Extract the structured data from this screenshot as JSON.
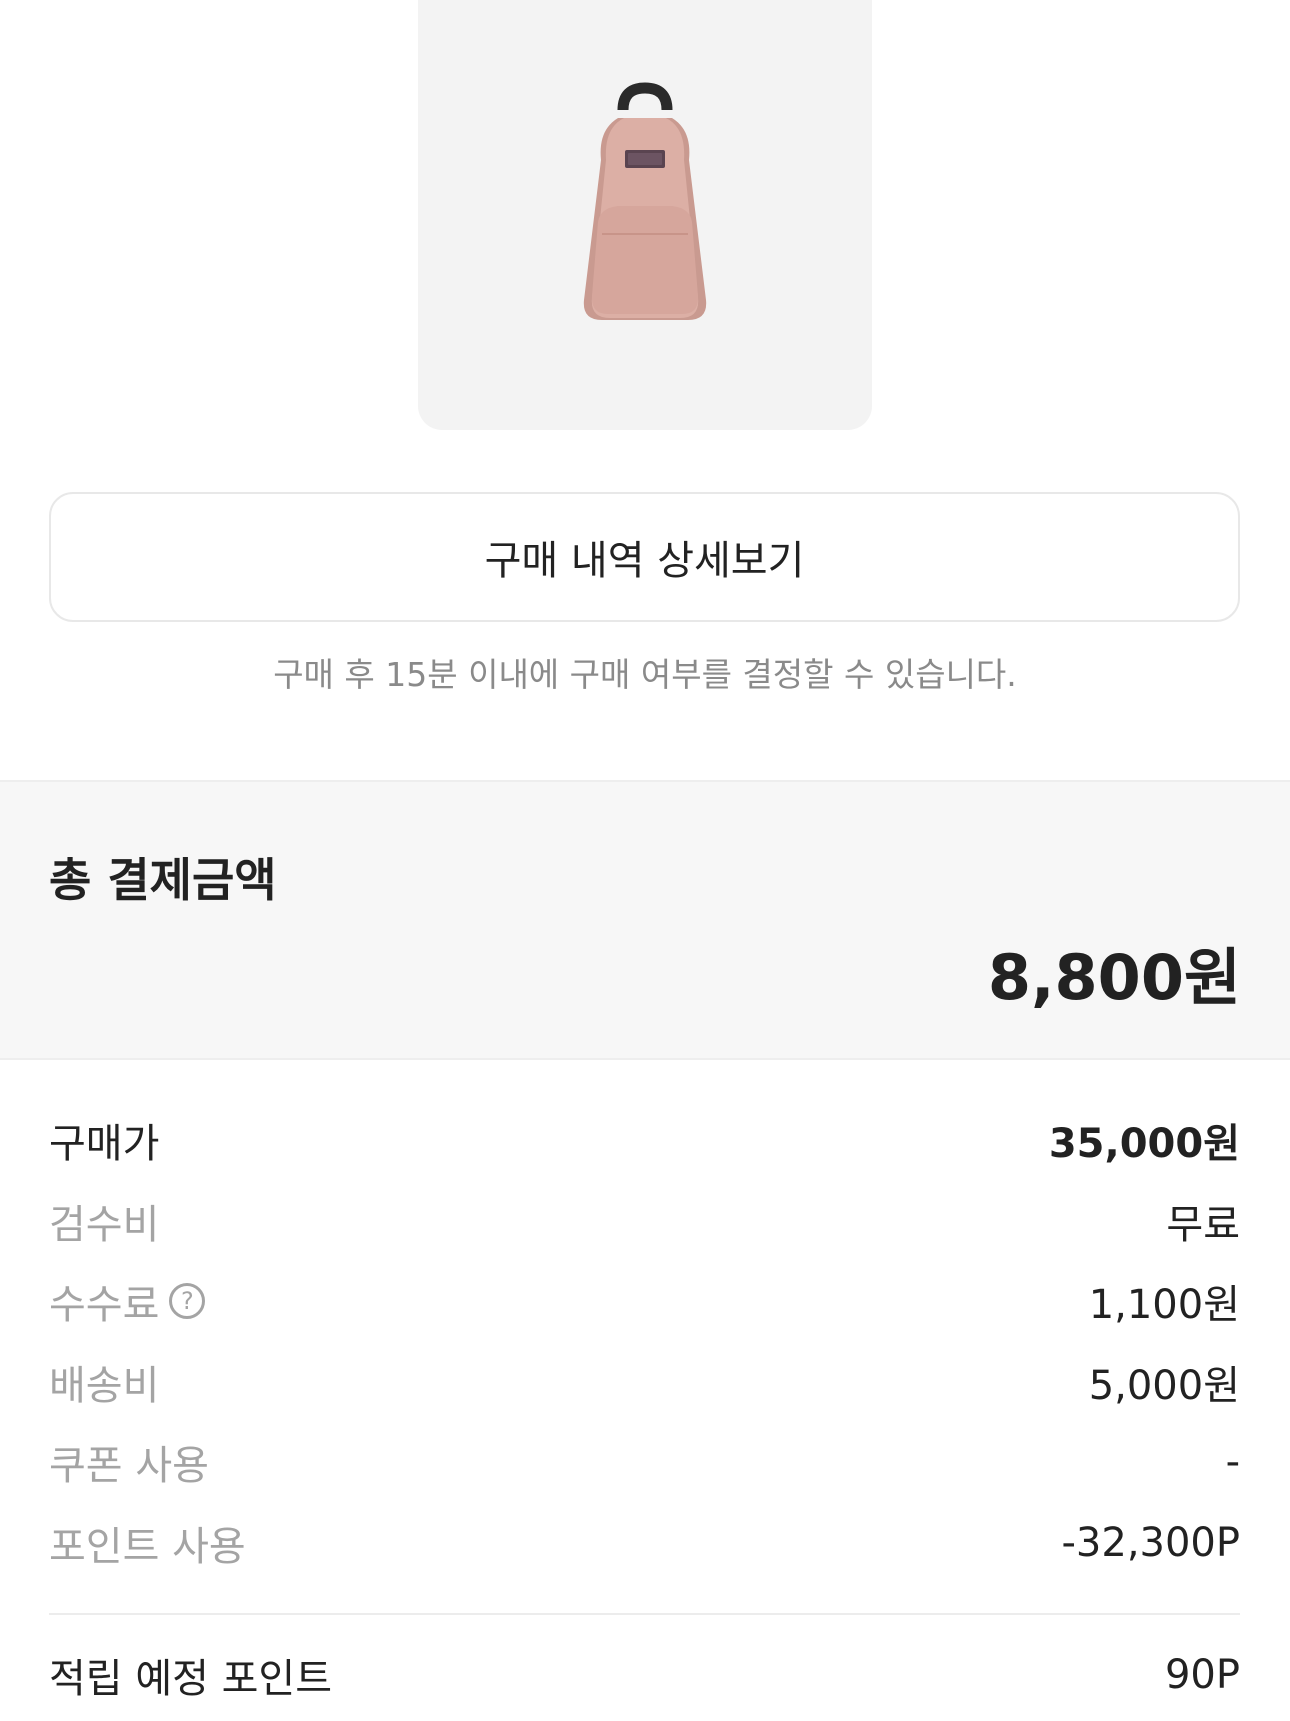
{
  "product": {
    "image": "pink-mini-backpack"
  },
  "detail_button_label": "구매 내역 상세보기",
  "notice": "구매 후 15분 이내에 구매 여부를 결정할 수 있습니다.",
  "total": {
    "title": "총 결제금액",
    "amount": "8,800원"
  },
  "breakdown": [
    {
      "label": "구매가",
      "value": "35,000원"
    },
    {
      "label": "검수비",
      "value": "무료"
    },
    {
      "label": "수수료",
      "value": "1,100원",
      "help_icon": "?"
    },
    {
      "label": "배송비",
      "value": "5,000원"
    },
    {
      "label": "쿠폰 사용",
      "value": "-"
    },
    {
      "label": "포인트 사용",
      "value": "-32,300P"
    }
  ],
  "points": {
    "label": "적립 예정 포인트",
    "value": "90P"
  },
  "colors": {
    "image_bg": "#f3f3f3",
    "section_bg": "#f7f7f7",
    "muted_text": "#a4a4a4",
    "backpack": "#dcafa5"
  }
}
